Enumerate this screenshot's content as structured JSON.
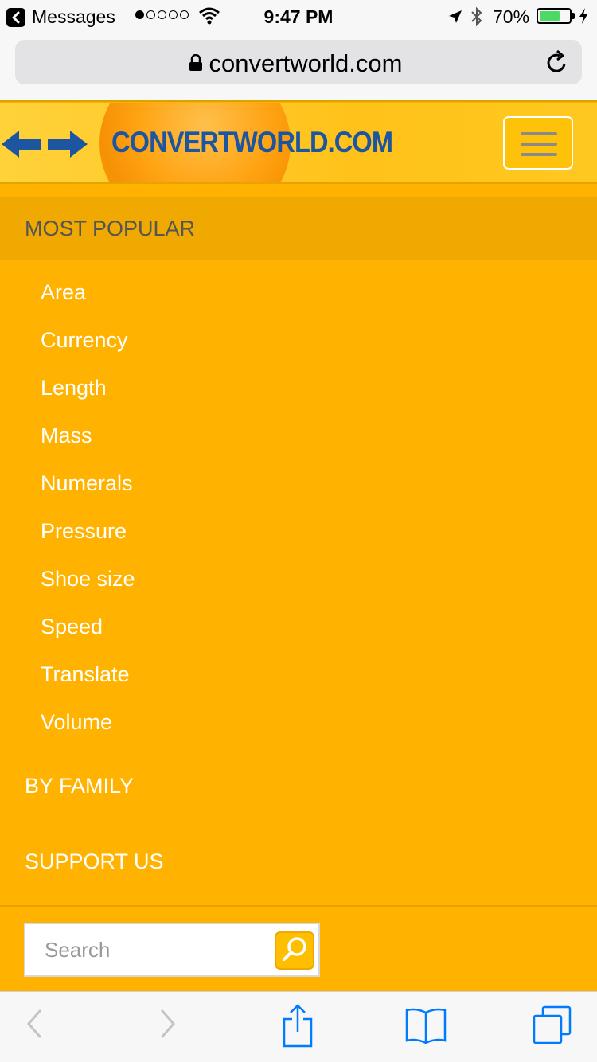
{
  "status_bar": {
    "back_app": "Messages",
    "time": "9:47 PM",
    "battery_percent": "70%",
    "battery_level": 0.7,
    "signal_bars_filled": 1,
    "signal_bars_total": 5
  },
  "browser": {
    "url": "convertworld.com"
  },
  "site": {
    "logo_text": "CONVERTWORLD.COM",
    "accent_color": "#ffb300",
    "logo_color": "#1d56a0"
  },
  "nav": {
    "active_section": "MOST POPULAR",
    "items": [
      {
        "label": "Area"
      },
      {
        "label": "Currency"
      },
      {
        "label": "Length"
      },
      {
        "label": "Mass"
      },
      {
        "label": "Numerals"
      },
      {
        "label": "Pressure"
      },
      {
        "label": "Shoe size"
      },
      {
        "label": "Speed"
      },
      {
        "label": "Translate"
      },
      {
        "label": "Volume"
      }
    ],
    "by_family": "BY FAMILY",
    "support_us": "SUPPORT US"
  },
  "search": {
    "placeholder": "Search",
    "value": ""
  },
  "icons": {
    "status": [
      "back-chevron-icon",
      "wifi-icon",
      "location-arrow-icon",
      "bluetooth-icon",
      "battery-icon",
      "charging-bolt-icon"
    ],
    "browser": [
      "lock-icon",
      "reload-icon"
    ],
    "header": [
      "logo-arrows-icon",
      "hamburger-menu-icon"
    ],
    "search": [
      "magnifier-icon"
    ],
    "toolbar": [
      "back-arrow-icon",
      "forward-arrow-icon",
      "share-icon",
      "bookmarks-icon",
      "tabs-icon"
    ]
  }
}
